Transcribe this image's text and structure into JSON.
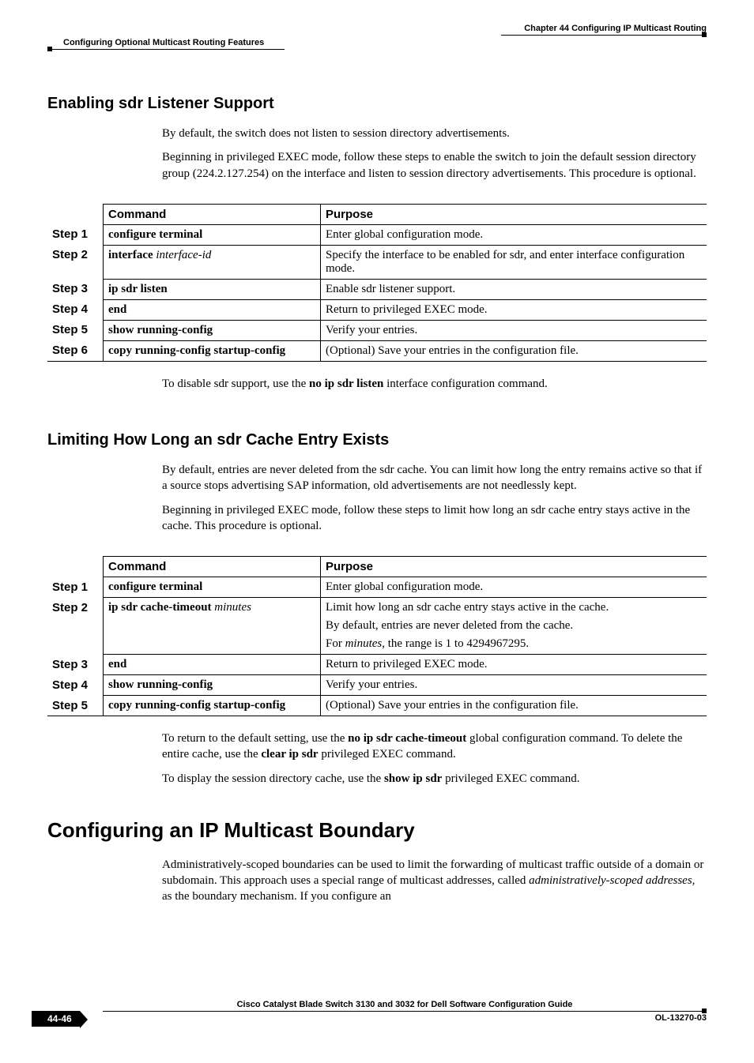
{
  "header": {
    "chapter": "Chapter 44    Configuring IP Multicast Routing",
    "subsection": "Configuring Optional Multicast Routing Features"
  },
  "sec1": {
    "title": "Enabling sdr Listener Support",
    "p1": "By default, the switch does not listen to session directory advertisements.",
    "p2": "Beginning in privileged EXEC mode, follow these steps to enable the switch to join the default session directory group (224.2.127.254) on the interface and listen to session directory advertisements. This procedure is optional.",
    "tbl": {
      "h1": "Command",
      "h2": "Purpose",
      "r1": {
        "step": "Step 1",
        "cmd_b": "configure terminal",
        "cmd_i": "",
        "purpose": "Enter global configuration mode."
      },
      "r2": {
        "step": "Step 2",
        "cmd_b": "interface ",
        "cmd_i": "interface-id",
        "purpose": "Specify the interface to be enabled for sdr, and enter interface configuration mode."
      },
      "r3": {
        "step": "Step 3",
        "cmd_b": "ip sdr listen",
        "cmd_i": "",
        "purpose": "Enable sdr listener support."
      },
      "r4": {
        "step": "Step 4",
        "cmd_b": "end",
        "cmd_i": "",
        "purpose": "Return to privileged EXEC mode."
      },
      "r5": {
        "step": "Step 5",
        "cmd_b": "show running-config",
        "cmd_i": "",
        "purpose": "Verify your entries."
      },
      "r6": {
        "step": "Step 6",
        "cmd_b": "copy running-config startup-config",
        "cmd_i": "",
        "purpose": "(Optional) Save your entries in the configuration file."
      }
    },
    "p3_a": "To disable sdr support, use the ",
    "p3_b": "no ip sdr listen",
    "p3_c": " interface configuration command."
  },
  "sec2": {
    "title": "Limiting How Long an sdr Cache Entry Exists",
    "p1": "By default, entries are never deleted from the sdr cache. You can limit how long the entry remains active so that if a source stops advertising SAP information, old advertisements are not needlessly kept.",
    "p2": "Beginning in privileged EXEC mode, follow these steps to limit how long an sdr cache entry stays active in the cache. This procedure is optional.",
    "tbl": {
      "h1": "Command",
      "h2": "Purpose",
      "r1": {
        "step": "Step 1",
        "cmd_b": "configure terminal",
        "cmd_i": "",
        "purpose": "Enter global configuration mode."
      },
      "r2": {
        "step": "Step 2",
        "cmd_b": "ip sdr cache-timeout ",
        "cmd_i": "minutes",
        "purpose1": "Limit how long an sdr cache entry stays active in the cache.",
        "purpose2": "By default, entries are never deleted from the cache.",
        "purpose3a": "For ",
        "purpose3b": "minutes",
        "purpose3c": ", the range is 1 to 4294967295."
      },
      "r3": {
        "step": "Step 3",
        "cmd_b": "end",
        "cmd_i": "",
        "purpose": "Return to privileged EXEC mode."
      },
      "r4": {
        "step": "Step 4",
        "cmd_b": "show running-config",
        "cmd_i": "",
        "purpose": "Verify your entries."
      },
      "r5": {
        "step": "Step 5",
        "cmd_b": "copy running-config startup-config",
        "cmd_i": "",
        "purpose": "(Optional) Save your entries in the configuration file."
      }
    },
    "p3_a": "To return to the default setting, use the ",
    "p3_b": "no ip sdr cache-timeout",
    "p3_c": " global configuration command. To delete the entire cache, use the ",
    "p3_d": "clear ip sdr",
    "p3_e": " privileged EXEC command.",
    "p4_a": "To display the session directory cache, use the ",
    "p4_b": "show ip sdr",
    "p4_c": " privileged EXEC command."
  },
  "sec3": {
    "title": "Configuring an IP Multicast Boundary",
    "p1_a": "Administratively-scoped boundaries can be used to limit the forwarding of multicast traffic outside of a domain or subdomain. This approach uses a special range of multicast addresses, called ",
    "p1_b": "administratively-scoped addresses",
    "p1_c": ", as the boundary mechanism. If you configure an"
  },
  "footer": {
    "title": "Cisco Catalyst Blade Switch 3130 and 3032 for Dell Software Configuration Guide",
    "page": "44-46",
    "doc": "OL-13270-03"
  }
}
